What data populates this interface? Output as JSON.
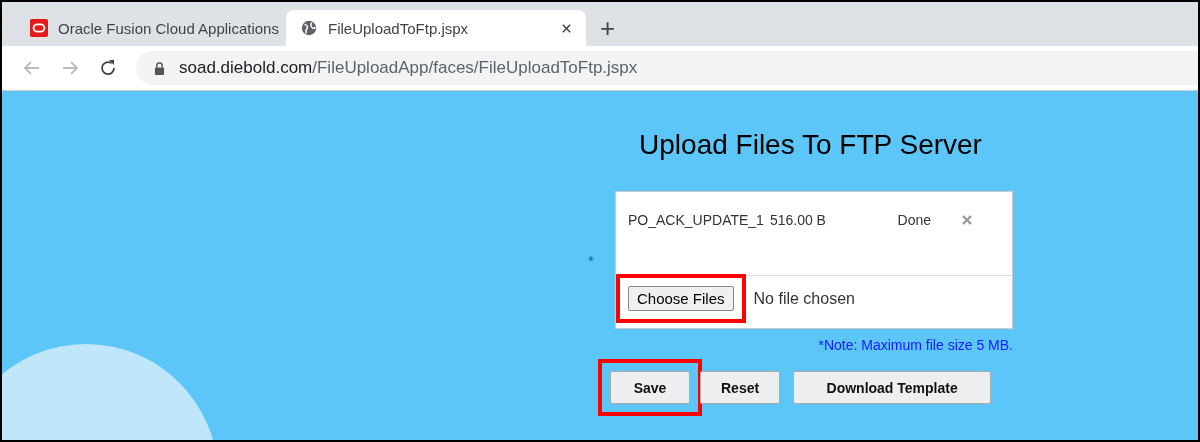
{
  "browser": {
    "tabs": [
      {
        "title": "Oracle Fusion Cloud Applications",
        "kind": "oracle",
        "selected": false
      },
      {
        "title": "FileUploadToFtp.jspx",
        "kind": "globe",
        "selected": true
      }
    ],
    "new_tab": "+",
    "address": {
      "domain": "soad.diebold.com",
      "path": "/FileUploadApp/faces/FileUploadToFtp.jspx"
    }
  },
  "page": {
    "title": "Upload Files To FTP Server",
    "required_mark": "*",
    "uploads": [
      {
        "name": "PO_ACK_UPDATE_1",
        "size": "516.00 B",
        "status": "Done"
      }
    ],
    "choose_button": "Choose Files",
    "file_status": "No file chosen",
    "note": "*Note: Maximum file size 5 MB.",
    "buttons": [
      {
        "label": "Save",
        "highlighted": true
      },
      {
        "label": "Reset",
        "highlighted": false
      },
      {
        "label": "Download Template",
        "highlighted": false
      }
    ],
    "choose_highlighted": true
  }
}
